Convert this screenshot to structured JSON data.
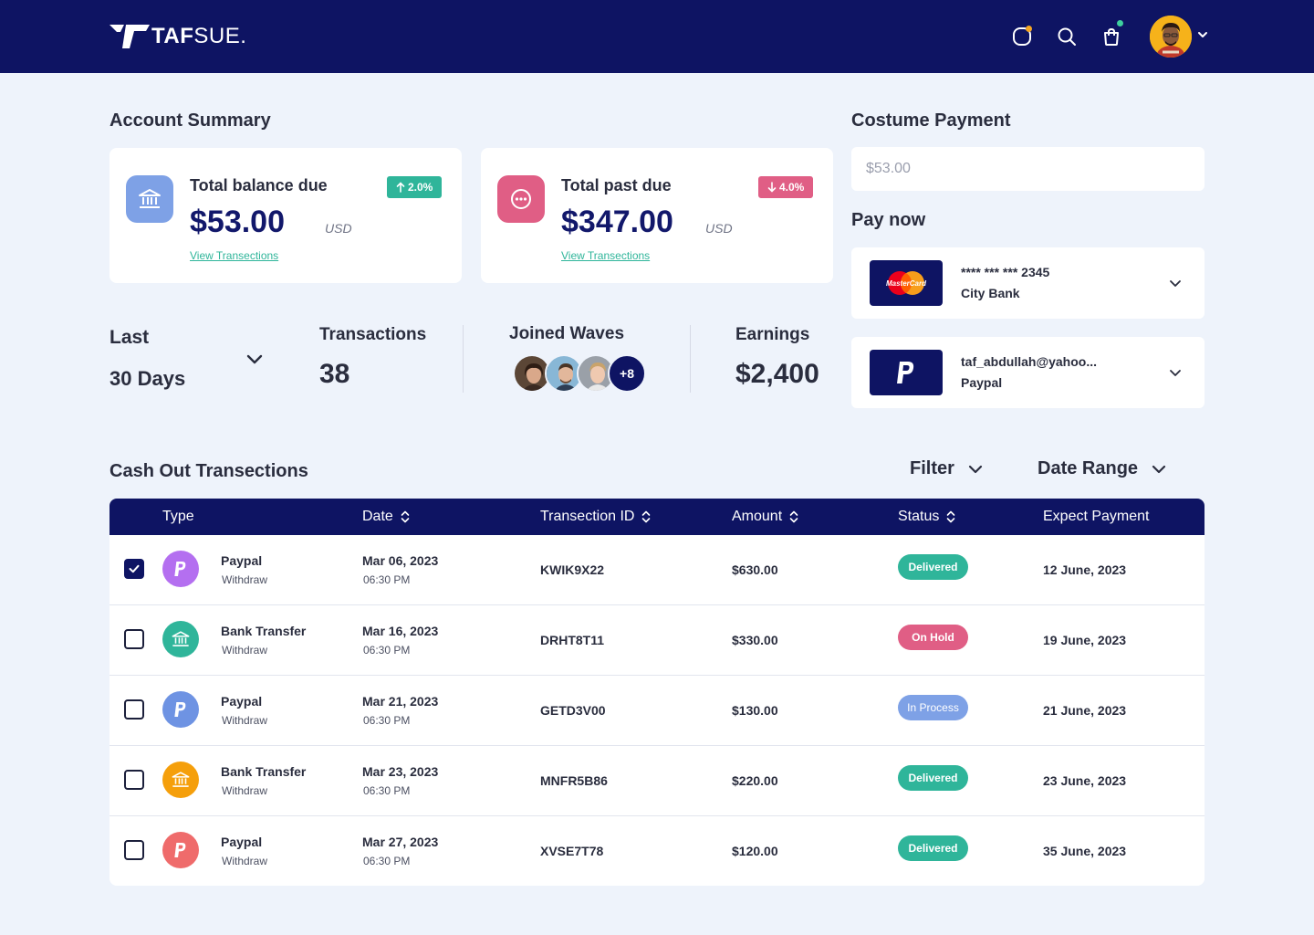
{
  "brand": {
    "name_bold": "TAF",
    "name_light": "SUE",
    "name_dot": "."
  },
  "colors": {
    "navy": "#0e1463",
    "green": "#2fb59a",
    "pink": "#e05e85",
    "purple": "#b46ff0",
    "teal": "#2fb59a",
    "blue": "#6e93e3",
    "orange": "#f59f0b",
    "coral": "#ef6b6b",
    "background": "#eef3fb"
  },
  "header": {
    "icons": [
      "notification-icon",
      "search-icon",
      "shopping-bag-icon"
    ],
    "avatar": "user-avatar"
  },
  "account_summary": {
    "title": "Account Summary",
    "cards": [
      {
        "icon": "bank-icon",
        "title": "Total balance due",
        "amount": "$53.00",
        "currency": "USD",
        "link": "View Transections",
        "change": "2.0%",
        "direction": "up"
      },
      {
        "icon": "dots-icon",
        "title": "Total past due",
        "amount": "$347.00",
        "currency": "USD",
        "link": "View Transections",
        "change": "4.0%",
        "direction": "down"
      }
    ]
  },
  "stats": {
    "period_line1": "Last",
    "period_line2": "30 Days",
    "transactions_label": "Transactions",
    "transactions_value": "38",
    "waves_label": "Joined Waves",
    "waves_more": "+8",
    "earnings_label": "Earnings",
    "earnings_value": "$2,400"
  },
  "costume_payment": {
    "title": "Costume Payment",
    "amount_value": "$53.00",
    "pay_now": "Pay now",
    "methods": [
      {
        "logo": "mastercard-logo",
        "logo_text": "MasterCard",
        "line1": "**** *** *** 2345",
        "line2": "City Bank"
      },
      {
        "logo": "paypal-logo",
        "line1": "taf_abdullah@yahoo...",
        "line2": "Paypal"
      }
    ]
  },
  "transactions": {
    "title": "Cash Out Transections",
    "filter_label": "Filter",
    "date_range_label": "Date Range",
    "columns": [
      "Type",
      "Date",
      "Transection ID",
      "Amount",
      "Status",
      "Expect Payment"
    ],
    "rows": [
      {
        "checked": true,
        "icon": "paypal-icon",
        "icon_color": "#b46ff0",
        "type": "Paypal",
        "kind": "Withdraw",
        "date": "Mar 06, 2023",
        "time": "06:30 PM",
        "id": "KWIK9X22",
        "amount": "$630.00",
        "status": "Delivered",
        "status_color": "#2fb59a",
        "expect": "12 June, 2023"
      },
      {
        "checked": false,
        "icon": "bank-icon",
        "icon_color": "#2fb59a",
        "type": "Bank Transfer",
        "kind": "Withdraw",
        "date": "Mar 16, 2023",
        "time": "06:30 PM",
        "id": "DRHT8T11",
        "amount": "$330.00",
        "status": "On Hold",
        "status_color": "#e05e85",
        "expect": "19 June, 2023"
      },
      {
        "checked": false,
        "icon": "paypal-icon",
        "icon_color": "#6e93e3",
        "type": "Paypal",
        "kind": "Withdraw",
        "date": "Mar 21, 2023",
        "time": "06:30 PM",
        "id": "GETD3V00",
        "amount": "$130.00",
        "status": "In Process",
        "status_color": "#7ea1e6",
        "expect": "21 June, 2023"
      },
      {
        "checked": false,
        "icon": "bank-icon",
        "icon_color": "#f59f0b",
        "type": "Bank Transfer",
        "kind": "Withdraw",
        "date": "Mar 23, 2023",
        "time": "06:30 PM",
        "id": "MNFR5B86",
        "amount": "$220.00",
        "status": "Delivered",
        "status_color": "#2fb59a",
        "expect": "23 June, 2023"
      },
      {
        "checked": false,
        "icon": "paypal-icon",
        "icon_color": "#ef6b6b",
        "type": "Paypal",
        "kind": "Withdraw",
        "date": "Mar 27, 2023",
        "time": "06:30 PM",
        "id": "XVSE7T78",
        "amount": "$120.00",
        "status": "Delivered",
        "status_color": "#2fb59a",
        "expect": "35 June, 2023"
      }
    ]
  }
}
